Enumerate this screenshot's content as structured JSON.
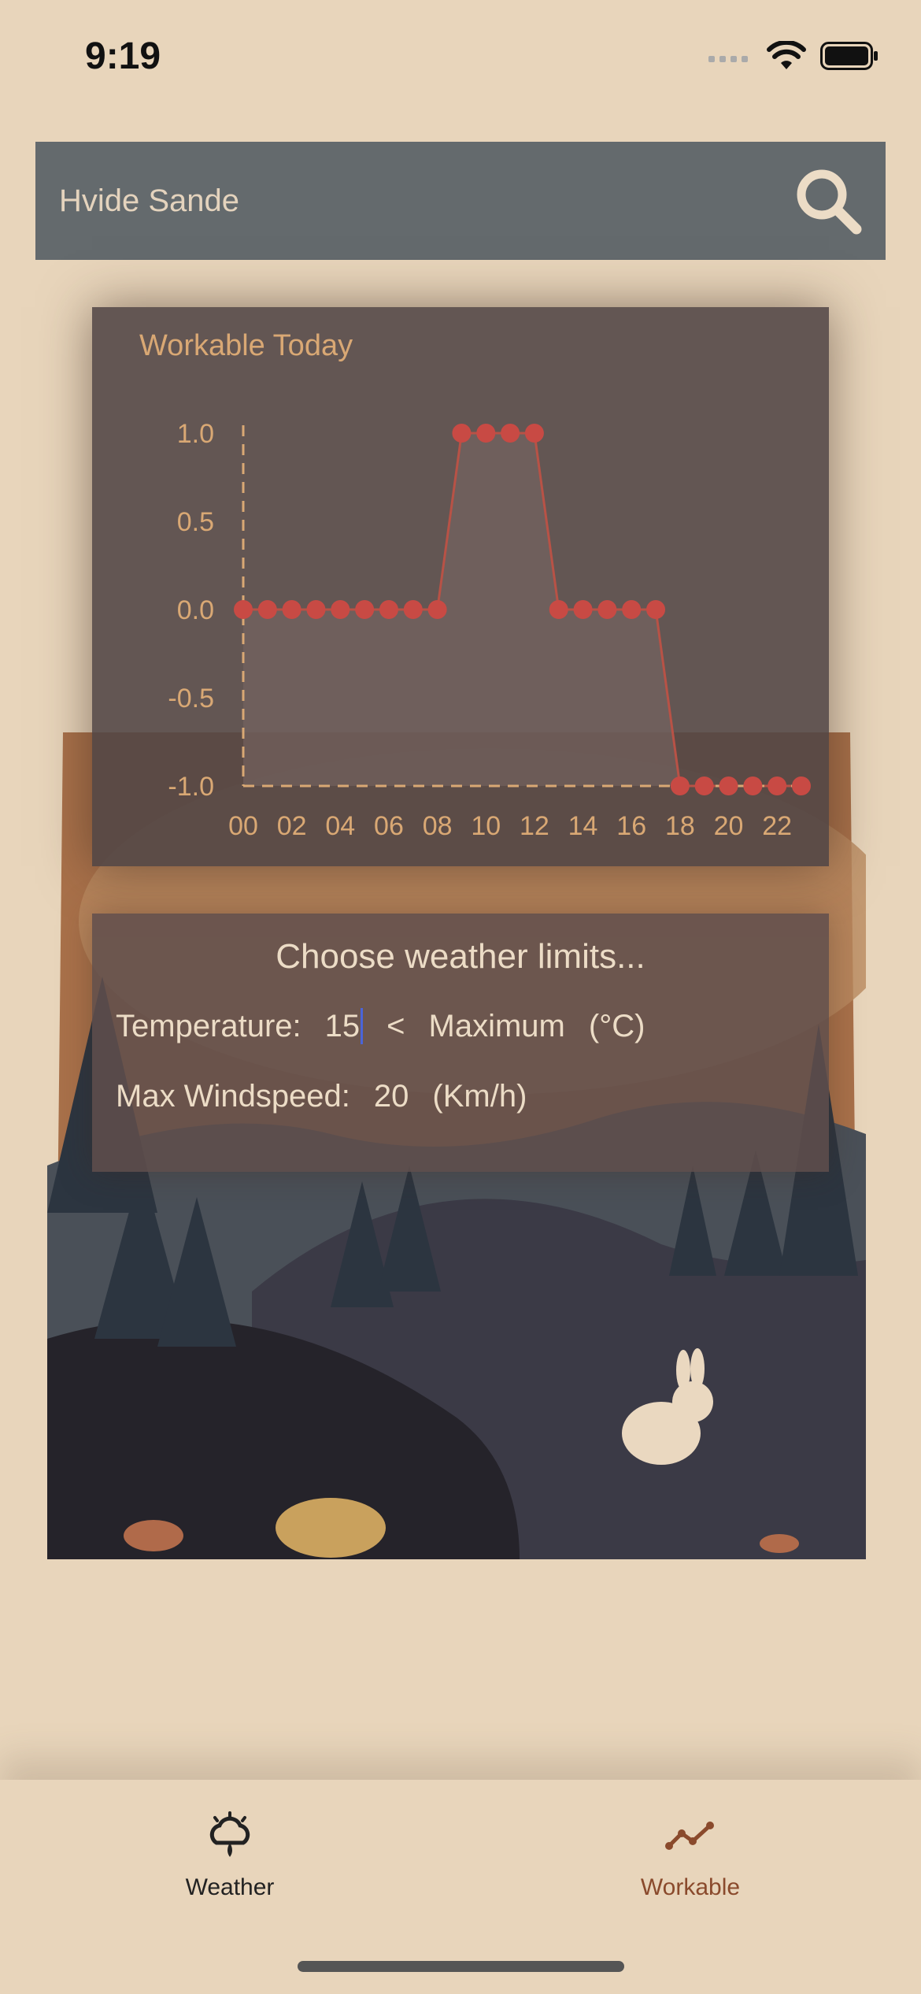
{
  "status_bar": {
    "time": "9:19",
    "icons": [
      "cellular-signal-icon",
      "wifi-icon",
      "battery-icon"
    ]
  },
  "search": {
    "value": "Hvide Sande",
    "button_icon": "search-icon"
  },
  "chart_card": {
    "title": "Workable Today"
  },
  "chart_data": {
    "type": "line",
    "title": "Workable Today",
    "xlabel": "",
    "ylabel": "",
    "x": [
      0,
      1,
      2,
      3,
      4,
      5,
      6,
      7,
      8,
      9,
      10,
      11,
      12,
      13,
      14,
      15,
      16,
      17,
      18,
      19,
      20,
      21,
      22,
      23
    ],
    "x_tick_labels": [
      "00",
      "02",
      "04",
      "06",
      "08",
      "10",
      "12",
      "14",
      "16",
      "18",
      "20",
      "22"
    ],
    "y_ticks": [
      "1.0",
      "0.5",
      "0.0",
      "-0.5",
      "-1.0"
    ],
    "ylim": [
      -1,
      1
    ],
    "series": [
      {
        "values": [
          0,
          0,
          0,
          0,
          0,
          0,
          0,
          0,
          0,
          1,
          1,
          1,
          1,
          0,
          0,
          0,
          0,
          0,
          -1,
          -1,
          -1,
          -1,
          -1,
          -1
        ]
      }
    ],
    "grid": false,
    "colors": {
      "point": "#c84a44",
      "line": "#b85246",
      "fill": "#7a6864",
      "axis": "#d9a874",
      "tick": "#d9a874"
    }
  },
  "limits": {
    "title": "Choose weather limits...",
    "temperature_label": "Temperature:",
    "temperature_value": "15",
    "comparator": "<",
    "temperature_mode": "Maximum",
    "temperature_unit": "(°C)",
    "wind_label": "Max Windspeed:",
    "wind_value": "20",
    "wind_unit": "(Km/h)"
  },
  "tabbar": {
    "tabs": [
      {
        "label": "Weather",
        "icon": "weather-cloud-icon",
        "active": false
      },
      {
        "label": "Workable",
        "icon": "chart-line-icon",
        "active": true
      }
    ],
    "active_color": "#8a4a2c"
  }
}
